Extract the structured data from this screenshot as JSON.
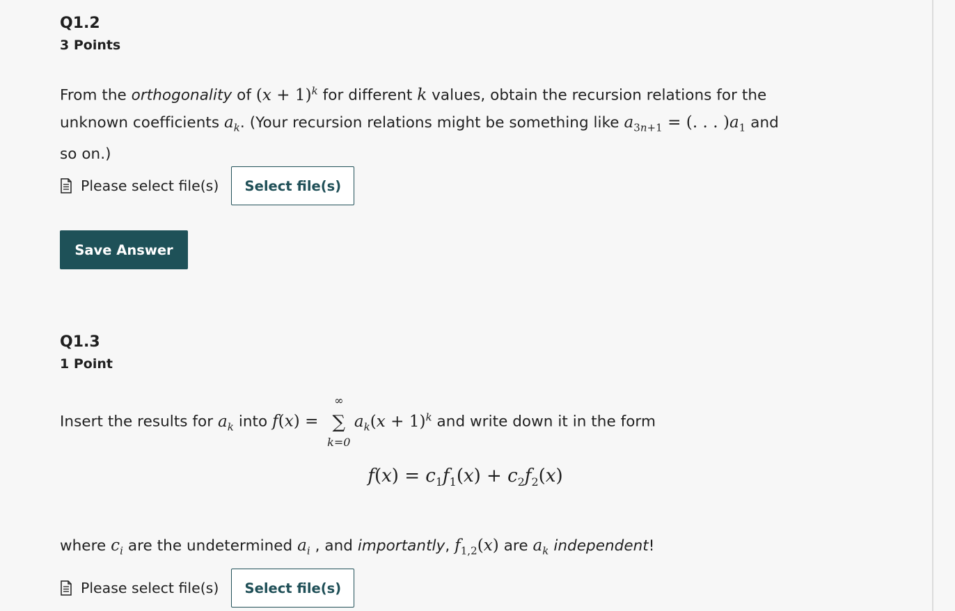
{
  "q12": {
    "title": "Q1.2",
    "points": "3 Points",
    "text": {
      "t1": "From the ",
      "t2": "orthogonality",
      "t3": " of ",
      "t5": " for different ",
      "t7": " values, obtain the recursion relations for the",
      "t8": "unknown coefficients ",
      "t10": ". (Your recursion relations might be something like ",
      "t12": " and",
      "t13": "so on.)"
    },
    "file_label": "Please select file(s)",
    "select_label": "Select file(s)",
    "save_label": "Save Answer"
  },
  "q13": {
    "title": "Q1.3",
    "points": "1 Point",
    "text": {
      "t1": "Insert the results for ",
      "t3": " into ",
      "t5": " and write down it in the form",
      "t6": "where ",
      "t8": " are the undetermined ",
      "t10": " , and ",
      "t11": "importantly",
      "t12": ", ",
      "t14": " are ",
      "t16": "independent",
      "t17": "!"
    },
    "file_label": "Please select file(s)",
    "select_label": "Select file(s)"
  },
  "icons": {
    "file": "document-icon"
  },
  "colors": {
    "accent": "#1e5158",
    "background": "#f7f7f7",
    "text": "#1f1f1f"
  }
}
